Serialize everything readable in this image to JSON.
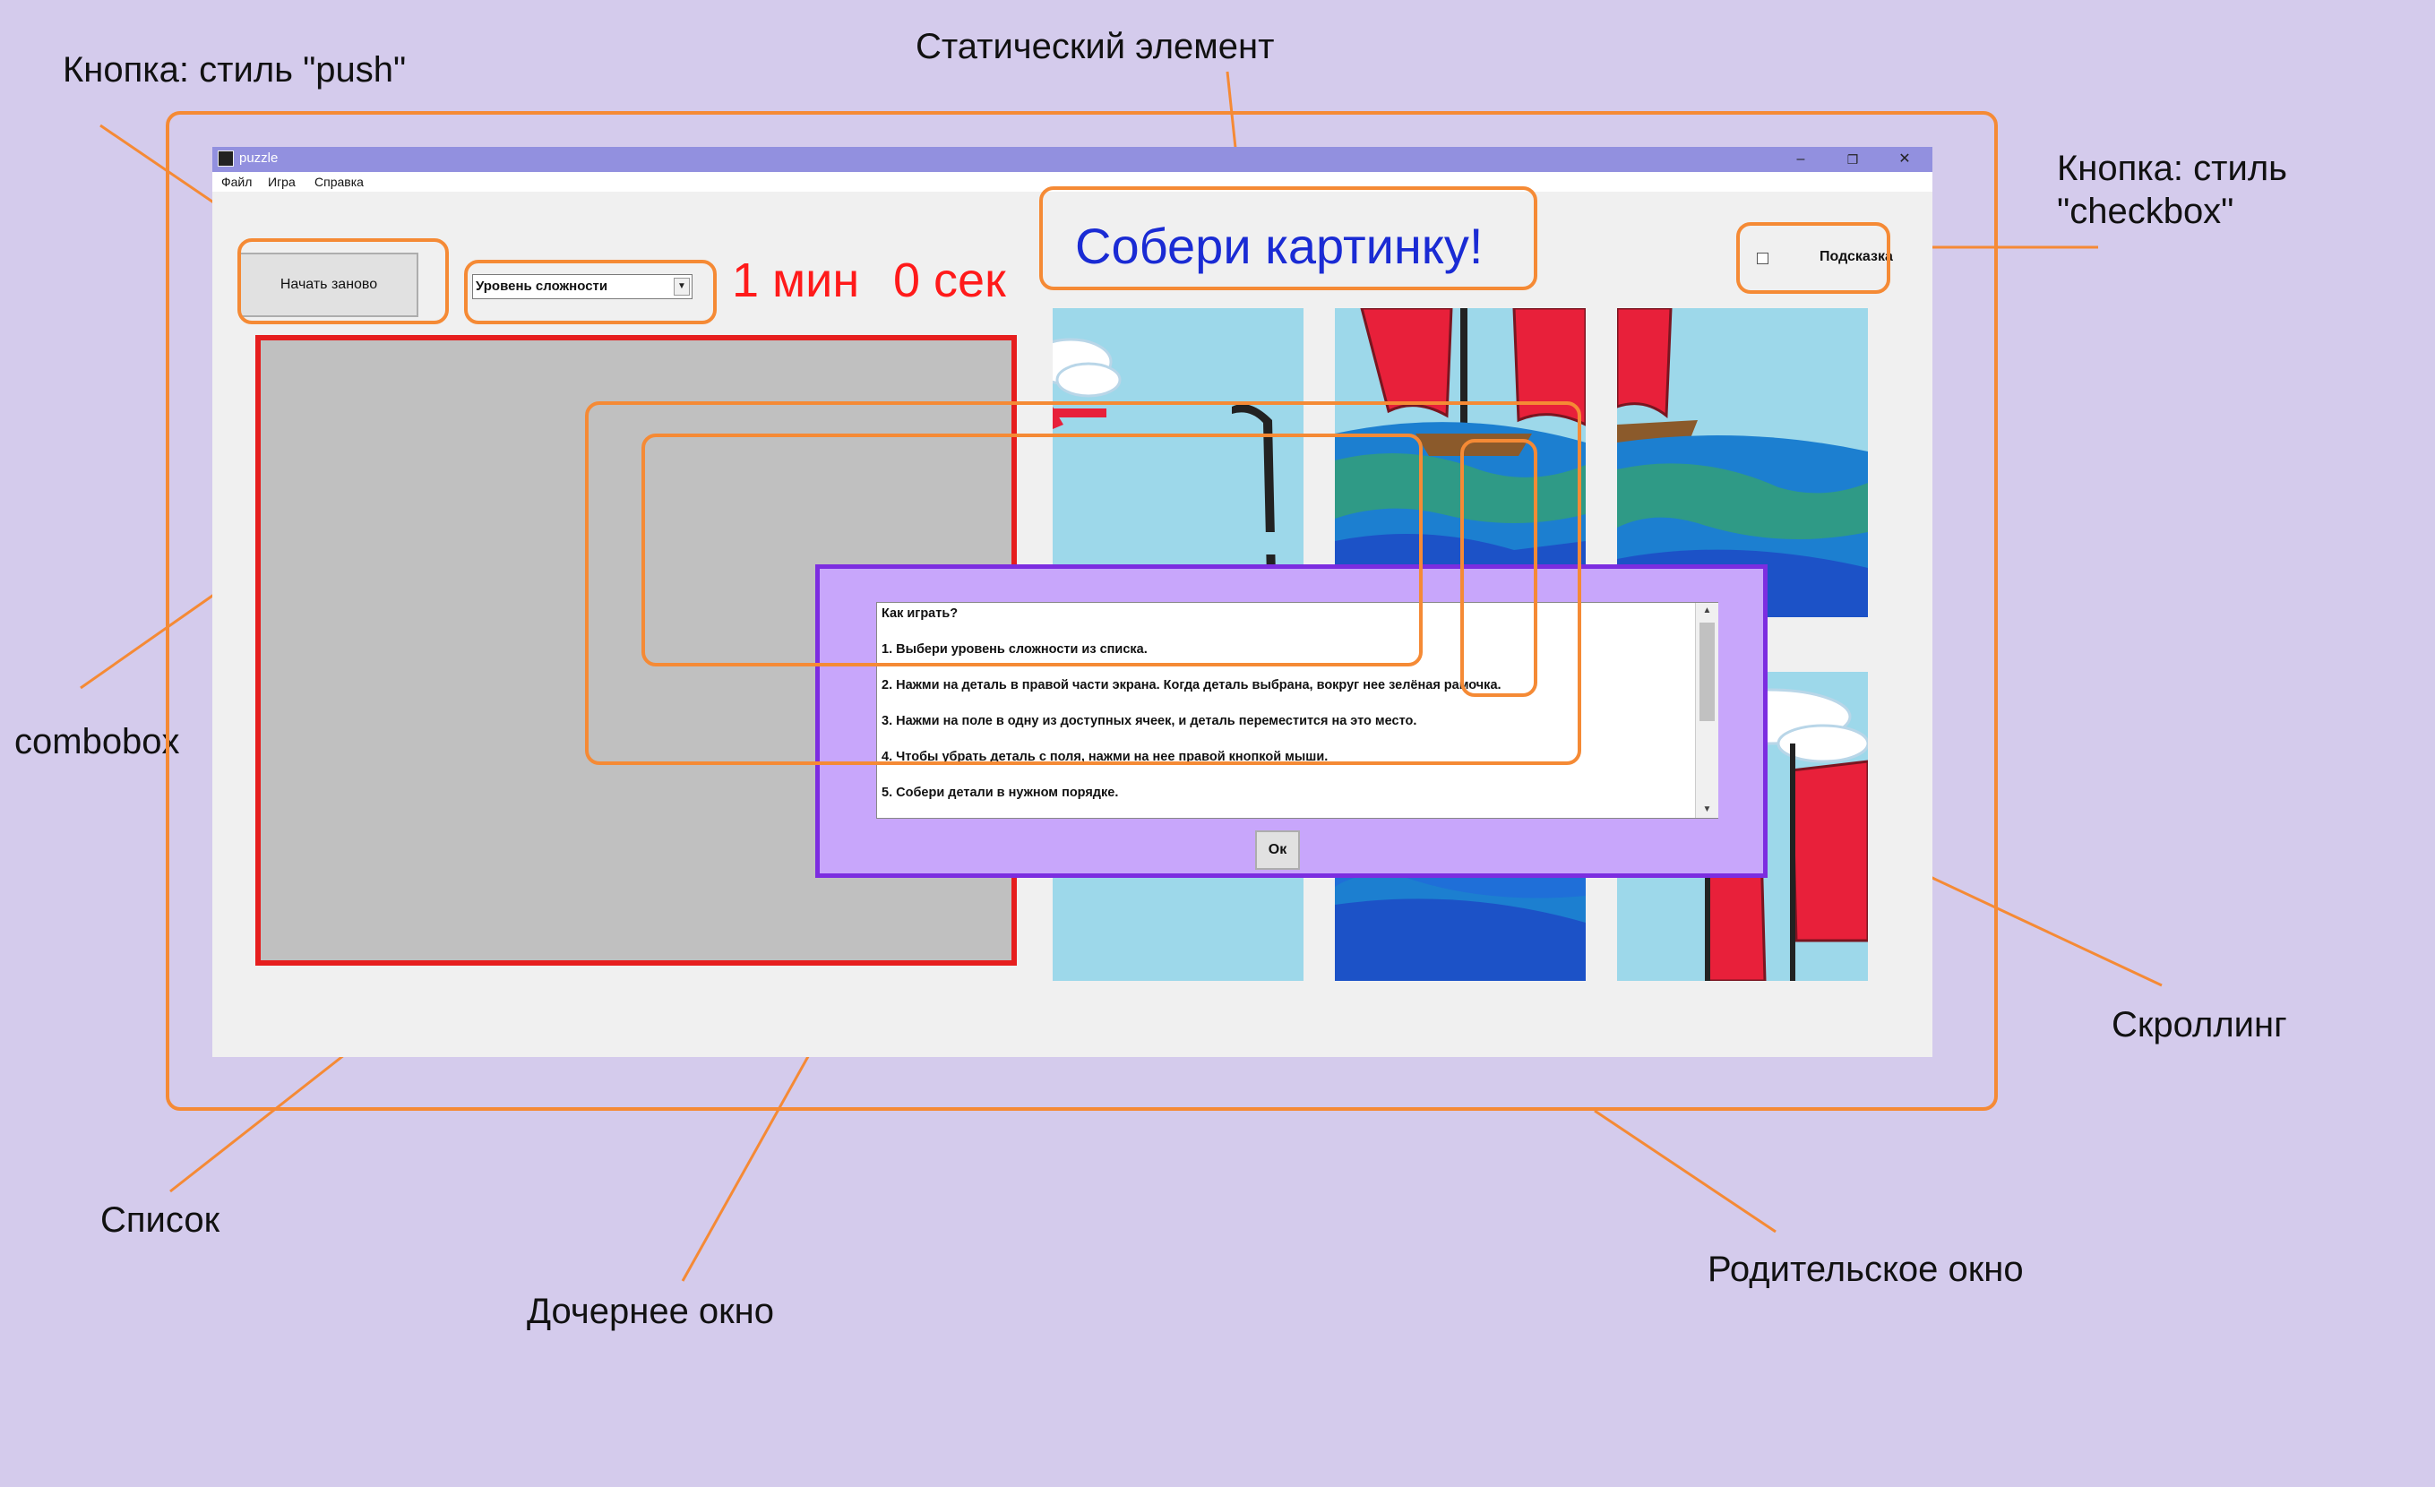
{
  "window": {
    "title": "puzzle",
    "controls": {
      "minimize": "–",
      "maximize": "❐",
      "close": "✕"
    },
    "menu": [
      "Файл",
      "Игра",
      "Справка"
    ]
  },
  "toolbar": {
    "restart_label": "Начать заново",
    "difficulty_selected": "Уровень сложности",
    "timer_min": "1 мин",
    "timer_sec": "0 сек",
    "static_title": "Собери картинку!",
    "hint_label": "Подсказка",
    "hint_checked": false
  },
  "dialog": {
    "lines": [
      "Как играть?",
      "1. Выбери уровень сложности из списка.",
      "2. Нажми на деталь в правой части экрана. Когда деталь выбрана, вокруг нее зелёная рамочка.",
      "3. Нажми на поле в одну из доступных ячеек, и деталь переместится на это место.",
      "4. Чтобы убрать деталь с поля, нажми на нее правой кнопкой мыши.",
      "5. Собери детали в нужном порядке."
    ],
    "ok_label": "Ок"
  },
  "annotations": {
    "push_button": "Кнопка: стиль \"push\"",
    "static_element": "Статический элемент",
    "checkbox_button": "Кнопка: стиль\n\"checkbox\"",
    "combobox": "combobox",
    "scrolling": "Скроллинг",
    "list": "Список",
    "child_window": "Дочернее окно",
    "parent_window": "Родительское окно"
  },
  "colors": {
    "background": "#d4cbec",
    "annotation_orange": "#f58a35",
    "titlebar": "#9290df",
    "timer_red": "#ff1a1a",
    "title_blue": "#1a2bd4",
    "dialog_bg": "#c8a6fb",
    "dialog_border": "#7c2de0",
    "sky": "#9dd8ea",
    "sail_red": "#e8203a"
  }
}
